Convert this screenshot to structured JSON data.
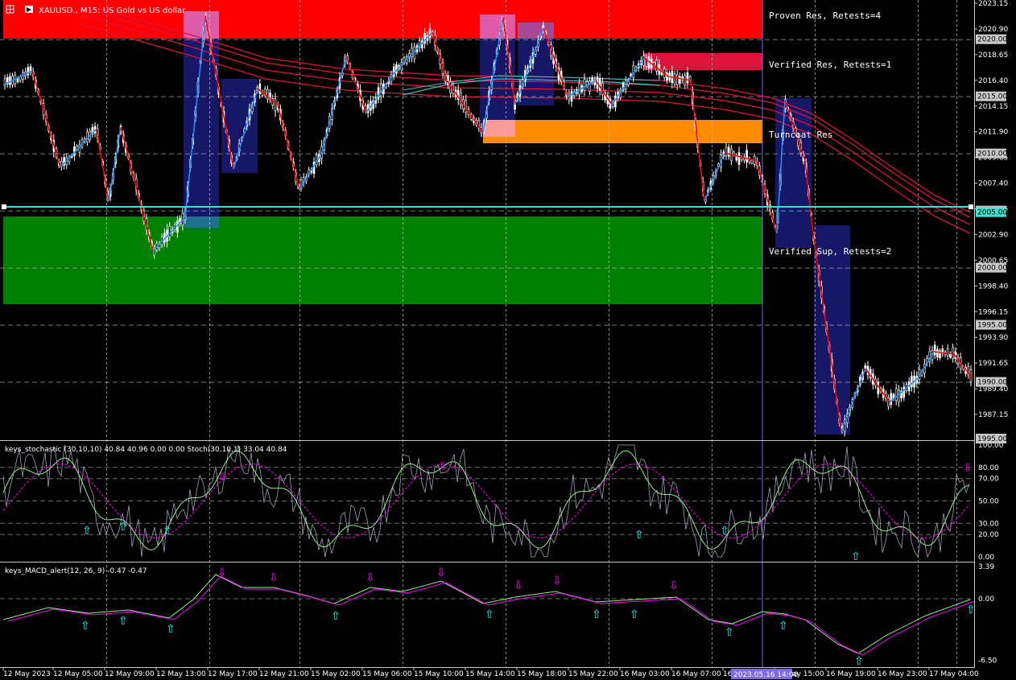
{
  "title": "XAUUSD., M15: US Gold vs US dollar",
  "colors": {
    "background": "#000000",
    "grid": "#c8c8c8",
    "bull_candle": "#ffffff",
    "proven_res_zone": "#ff0000",
    "verified_res_zone": "#dc143c",
    "turncoat_zone": "#ff8c00",
    "verified_sup_zone": "#008000",
    "zigzag_up": "#1e90ff",
    "zigzag_down": "#ff0000",
    "ma_ribbon": "#dc143c",
    "ma_ribbon_teal": "#40c0c0",
    "session_box": "#191970",
    "session_box_pink": "#ff69b4",
    "crosshair_line": "#40e0d0",
    "vertical_marker": "#7b68ee",
    "stoch_main": "#90ee90",
    "stoch_signal": "#ff00ff",
    "arrow_up": "#00ffff",
    "arrow_down": "#ff00ff"
  },
  "zones": [
    {
      "label": "Proven Res, Retests=4",
      "icon": "proven-res-zone"
    },
    {
      "label": "Verified Res, Retests=1",
      "icon": "verified-res-zone"
    },
    {
      "label": "Turncoat Res",
      "icon": "turncoat-res-zone"
    },
    {
      "label": "Verified Sup, Retests=2",
      "icon": "verified-sup-zone"
    }
  ],
  "price_axis": {
    "ticks": [
      "2023.15",
      "2020.90",
      "2018.65",
      "2016.40",
      "2014.15",
      "2011.90",
      "2009.65",
      "2007.40",
      "2005.15",
      "2002.90",
      "2000.65",
      "1998.40",
      "1996.15",
      "1993.90",
      "1991.65",
      "1989.40",
      "1987.15"
    ],
    "tags": [
      "2020.00",
      "2015.00",
      "2010.00",
      "2005.00",
      "2000.00",
      "1995.00",
      "1990.00",
      "1995.00"
    ],
    "crosshair_price": "2005.00"
  },
  "stochastic": {
    "label": "keys_stochastic (30,10,10) 40.84 40.96 0.00 0.00 Stoch(30,10,1) 33.04 40.84",
    "ticks": [
      "100.00",
      "80.00",
      "70.00",
      "50.00",
      "30.00",
      "20.00",
      "0.00"
    ]
  },
  "macd": {
    "label": "keys_MACD_alert(12, 26, 9) -0.47 -0.47",
    "ticks": [
      "3.39",
      "0.00",
      "-6.50"
    ]
  },
  "time_axis": {
    "labels": [
      "12 May 2023",
      "12 May 05:00",
      "12 May 09:00",
      "12 May 13:00",
      "12 May 17:00",
      "12 May 21:00",
      "15 May 02:00",
      "15 May 06:00",
      "15 May 10:00",
      "15 May 14:00",
      "15 May 18:00",
      "15 May 22:00",
      "16 May 03:00",
      "16 May 07:00",
      "16 May 11:00",
      "16 May 15:00",
      "16 May 19:00",
      "16 May 23:00",
      "17 May 04:00"
    ],
    "highlight": "2023.05.16 14:00"
  },
  "icons": {
    "chart-type": "grid-icon",
    "one-click": "one-click-icon"
  }
}
